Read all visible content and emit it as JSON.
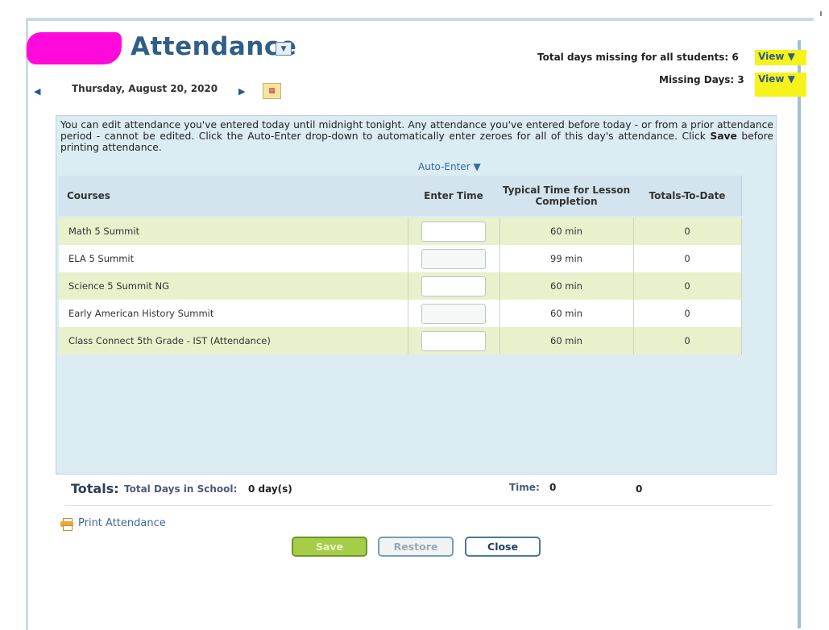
{
  "header": {
    "title": "Attendance",
    "date": "Thursday, August 20, 2020",
    "missing_all_label": "Total days missing for all students:",
    "missing_all_value": "6",
    "missing_days_label": "Missing Days:",
    "missing_days_value": "3",
    "view_label": "View ▼"
  },
  "notice": {
    "part1": "You can edit attendance you've entered today until midnight tonight. Any attendance you've entered before today - or from a prior attendance period - cannot be edited. Click the Auto-Enter drop-down to automatically enter zeroes for all of this day's attendance. Click ",
    "bold": "Save",
    "part2": " before printing attendance."
  },
  "auto_enter": "Auto-Enter ▼",
  "table": {
    "headers": [
      "Courses",
      "Enter Time",
      "Typical Time for Lesson Completion",
      "Totals-To-Date"
    ],
    "rows": [
      {
        "course": "Math 5 Summit",
        "typical": "60 min",
        "total": "0"
      },
      {
        "course": "ELA 5 Summit",
        "typical": "99 min",
        "total": "0"
      },
      {
        "course": "Science 5 Summit NG",
        "typical": "60 min",
        "total": "0"
      },
      {
        "course": "Early American History Summit",
        "typical": "60 min",
        "total": "0"
      },
      {
        "course": "Class Connect 5th Grade - IST (Attendance)",
        "typical": "60 min",
        "total": "0"
      }
    ]
  },
  "totals": {
    "label": "Totals:",
    "days_label": "Total Days in School:",
    "days_value": "0 day(s)",
    "time_label": "Time:",
    "time_value": "0",
    "total_value": "0"
  },
  "print_label": "Print Attendance",
  "buttons": {
    "save": "Save",
    "restore": "Restore",
    "close": "Close"
  },
  "colors": {
    "title": "#2f5f86",
    "highlight": "#f6f21c",
    "row_alt": "#e9f0cc",
    "panel": "#dcecf3",
    "save": "#a6cd47"
  }
}
